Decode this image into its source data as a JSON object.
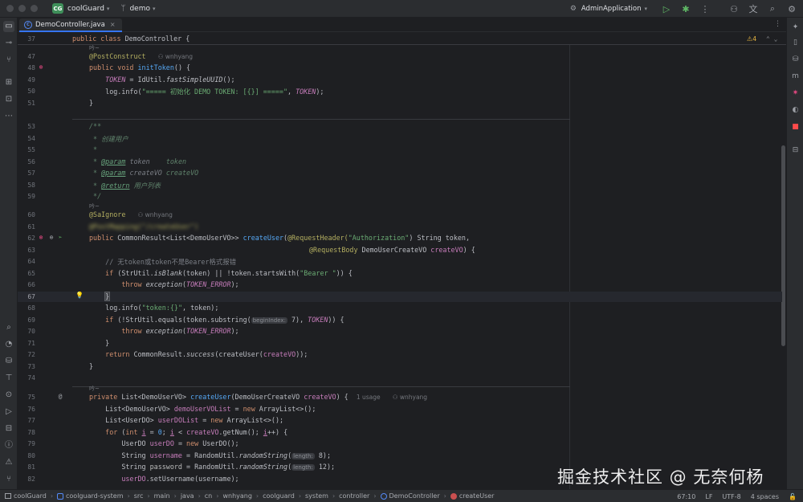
{
  "titlebar": {
    "project_badge": "CG",
    "project_name": "coolGuard",
    "branch": "demo",
    "run_config": "AdminApplication"
  },
  "tab": {
    "label": "DemoController.java"
  },
  "editor": {
    "warning_count": "4",
    "sticky": {
      "num": "37",
      "text": "public class DemoController {"
    },
    "lines": [
      {
        "num": "47"
      },
      {
        "num": "48"
      },
      {
        "num": "49"
      },
      {
        "num": "50"
      },
      {
        "num": "51"
      },
      {
        "num": "53"
      },
      {
        "num": "54"
      },
      {
        "num": "55"
      },
      {
        "num": "56"
      },
      {
        "num": "57"
      },
      {
        "num": "58"
      },
      {
        "num": "59"
      },
      {
        "num": "60"
      },
      {
        "num": "61"
      },
      {
        "num": "62"
      },
      {
        "num": "63"
      },
      {
        "num": "64"
      },
      {
        "num": "65"
      },
      {
        "num": "66"
      },
      {
        "num": "67"
      },
      {
        "num": "68"
      },
      {
        "num": "69"
      },
      {
        "num": "70"
      },
      {
        "num": "71"
      },
      {
        "num": "72"
      },
      {
        "num": "73"
      },
      {
        "num": "74"
      },
      {
        "num": "75"
      },
      {
        "num": "76"
      },
      {
        "num": "77"
      },
      {
        "num": "78"
      },
      {
        "num": "79"
      },
      {
        "num": "80"
      },
      {
        "num": "81"
      },
      {
        "num": "82"
      }
    ],
    "author": "wnhyang",
    "usage": "1 usage",
    "annotation_glyph": "吟~",
    "code": {
      "l47a": "@PostConstruct",
      "l48k": "public void ",
      "l48f": "initToken",
      "l48r": "() {",
      "l49v": "TOKEN",
      "l49r1": " = IdUtil.",
      "l49m": "fastSimpleUUID",
      "l49r2": "();",
      "l50r1": "log.info(",
      "l50s": "\"===== 初始化 DEMO TOKEN: [{}] =====\"",
      "l50r2": ", ",
      "l50v": "TOKEN",
      "l50r3": ");",
      "l51": "}",
      "l53": "/**",
      "l54": " * 创建用户",
      "l55": " *",
      "l56t": "@param",
      "l56p1": " token",
      "l56p2": "    token",
      "l57t": "@param",
      "l57p1": " createVO",
      "l57p2": " createVO",
      "l58t": "@return",
      "l58p": " 用户列表",
      "l59": " */",
      "l60": "@SaIgnore",
      "l61": "@PostMapping(\"/createUser\")",
      "l62k": "public ",
      "l62t": "CommonResult<List<DemoUserVO>> ",
      "l62f": "createUser",
      "l62r1": "(",
      "l62a": "@RequestHeader(",
      "l62s": "\"Authorization\"",
      "l62r2": ") String token,",
      "l63a": "@RequestBody",
      "l63r": " DemoUserCreateVO ",
      "l63p": "createVO",
      "l63e": ") {",
      "l64": "// 无token或token不是Bearer格式报错",
      "l65k": "if ",
      "l65r1": "(StrUtil.",
      "l65m": "isBlank",
      "l65r2": "(token) || !token.startsWith(",
      "l65s": "\"Bearer \"",
      "l65r3": ")) {",
      "l66k": "throw ",
      "l66m": "exception",
      "l66r1": "(",
      "l66v": "TOKEN_ERROR",
      "l66r2": ");",
      "l67": "}",
      "l68r1": "log.info(",
      "l68s": "\"token:{}\"",
      "l68r2": ", token);",
      "l69k": "if ",
      "l69r1": "(!StrUtil.equals(token.substring(",
      "l69h": "beginIndex:",
      "l69r2": " 7), ",
      "l69v": "TOKEN",
      "l69r3": ")) {",
      "l70k": "throw ",
      "l70m": "exception",
      "l70r1": "(",
      "l70v": "TOKEN_ERROR",
      "l70r2": ");",
      "l71": "}",
      "l72k": "return ",
      "l72r1": "CommonResult.",
      "l72m": "success",
      "l72r2": "(createUser(",
      "l72p": "createVO",
      "l72r3": "));",
      "l73": "}",
      "l75k": "private ",
      "l75t": "List<DemoUserVO> ",
      "l75f": "createUser",
      "l75r1": "(DemoUserCreateVO ",
      "l75p": "createVO",
      "l75r2": ") {",
      "l76r1": "List<DemoUserVO> ",
      "l76v": "demoUserVOList",
      "l76r2": " = ",
      "l76k": "new ",
      "l76r3": "ArrayList<>();",
      "l77r1": "List<UserDO> ",
      "l77v": "userDOList",
      "l77r2": " = ",
      "l77k": "new ",
      "l77r3": "ArrayList<>();",
      "l78k1": "for ",
      "l78r1": "(",
      "l78k2": "int ",
      "l78v1": "i",
      "l78r2": " = ",
      "l78n": "0",
      "l78r3": "; ",
      "l78v2": "i",
      "l78r4": " < ",
      "l78p": "createVO",
      "l78r5": ".getNum(); ",
      "l78v3": "i",
      "l78r6": "++) {",
      "l79r1": "UserDO ",
      "l79v": "userDO",
      "l79r2": " = ",
      "l79k": "new ",
      "l79r3": "UserDO();",
      "l80r1": "String ",
      "l80v": "username",
      "l80r2": " = RandomUtil.",
      "l80m": "randomString",
      "l80r3": "(",
      "l80h": "length:",
      "l80r4": " 8);",
      "l81r1": "String ",
      "l81v": "password",
      "l81r2": " = RandomUtil.",
      "l81m": "randomString",
      "l81r3": "(",
      "l81h": "length:",
      "l81r4": " 12);",
      "l82v": "userDO",
      "l82r": ".setUsername(username);"
    }
  },
  "statusbar": {
    "crumbs": [
      "coolGuard",
      "coolguard-system",
      "src",
      "main",
      "java",
      "cn",
      "wnhyang",
      "coolguard",
      "system",
      "controller",
      "DemoController",
      "createUser"
    ],
    "position": "67:10",
    "line_sep": "LF",
    "encoding": "UTF-8",
    "indent": "4 spaces"
  },
  "watermark": "掘金技术社区 @ 无奈何杨"
}
